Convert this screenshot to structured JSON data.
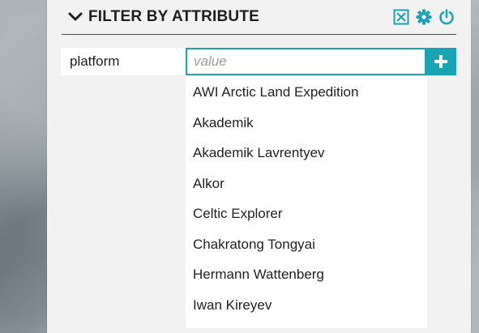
{
  "panel": {
    "title": "FILTER BY ATTRIBUTE",
    "icons": [
      "chevron-down-icon",
      "clear-filter-icon",
      "gear-icon",
      "power-icon"
    ],
    "accent_color": "#1aa3b3"
  },
  "filter": {
    "attribute": "platform",
    "value_placeholder": "value",
    "value": ""
  },
  "dropdown": {
    "options": [
      "AWI Arctic Land Expedition",
      "Akademik",
      "Akademik Lavrentyev",
      "Alkor",
      "Celtic Explorer",
      "Chakratong Tongyai",
      "Hermann Wattenberg",
      "Iwan Kireyev"
    ]
  }
}
